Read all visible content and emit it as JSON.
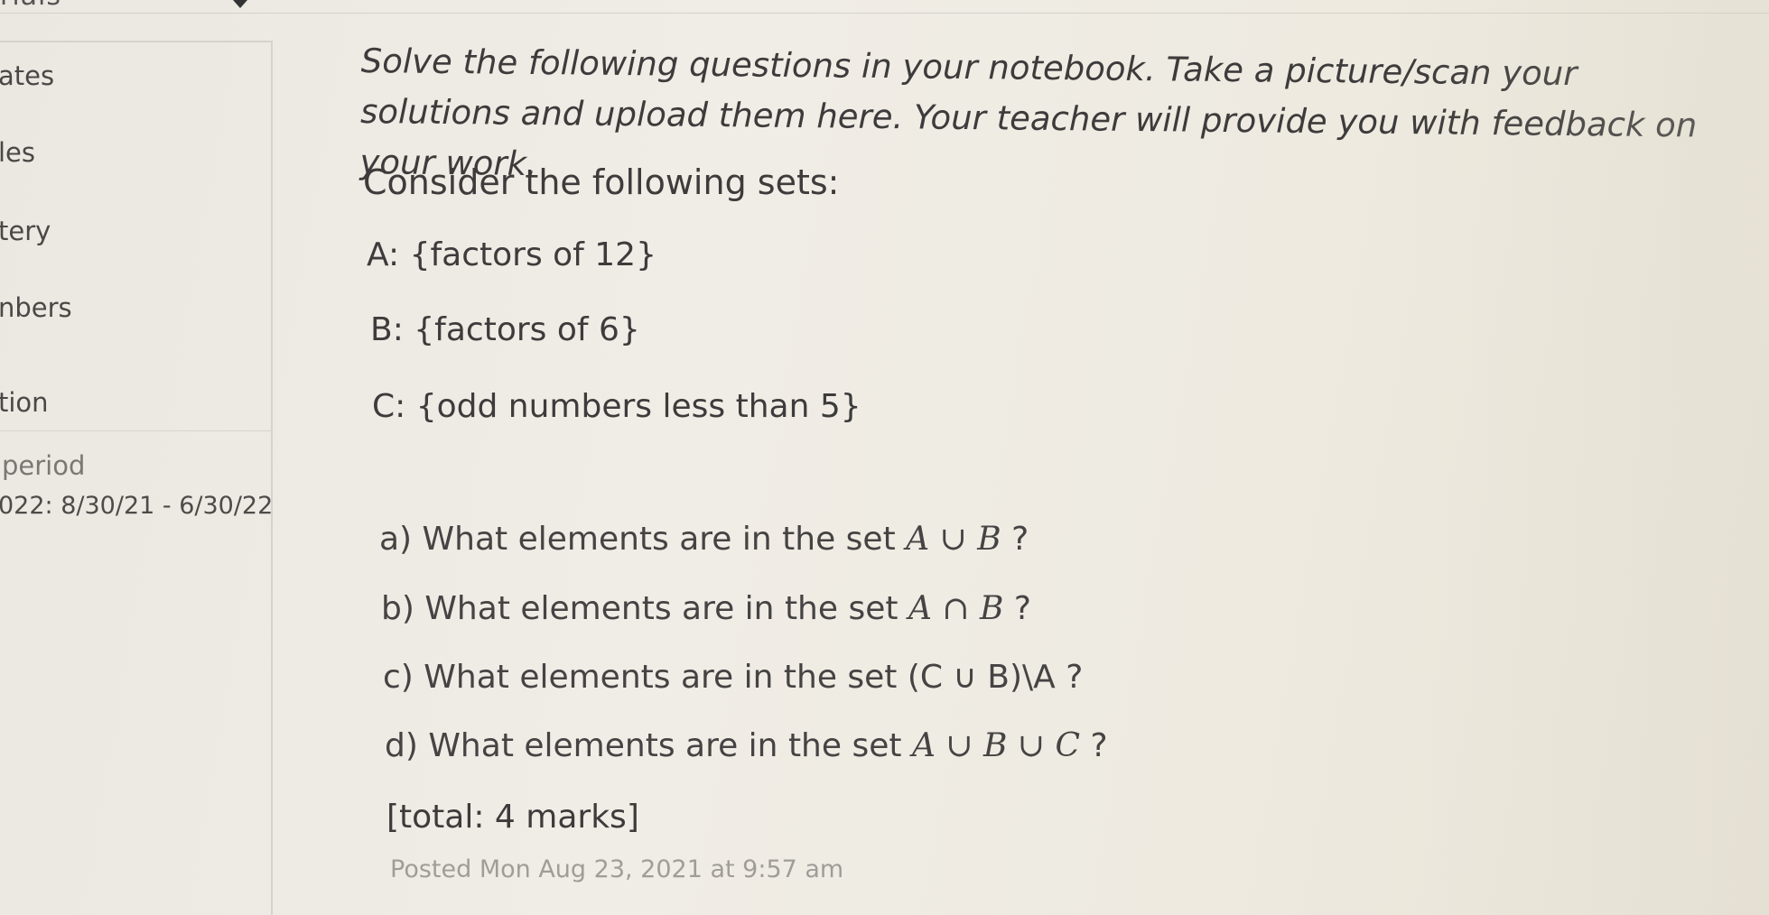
{
  "top_bar": {
    "cut_label": "rials"
  },
  "sidebar": {
    "items": [
      {
        "label": "ates"
      },
      {
        "label": "les"
      },
      {
        "label": "tery"
      },
      {
        "label": "nbers"
      },
      {
        "label": "tion"
      }
    ],
    "period_label": "period",
    "period_dates": "022: 8/30/21 - 6/30/22"
  },
  "assignment": {
    "instructions": "Solve the following questions in your notebook. Take a picture/scan your solutions and upload them here. Your teacher will provide you with feedback on your work.",
    "sets_heading": "Consider the following sets:",
    "sets": [
      "A: {factors of 12}",
      "B: {factors of 6}",
      "C: {odd numbers less than 5}"
    ],
    "questions": [
      {
        "prefix": "a) What elements are in the set ",
        "math": "A ∪ B",
        "suffix": " ?"
      },
      {
        "prefix": "b) What elements are in the set ",
        "math": "A ∩ B",
        "suffix": " ?"
      },
      {
        "prefix": "c) What elements are in the set (C ∪ B)\\A ?",
        "math": "",
        "suffix": ""
      },
      {
        "prefix": "d) What elements are in the set ",
        "math": "A ∪ B ∪ C",
        "suffix": " ?"
      }
    ],
    "total": "[total: 4 marks]",
    "posted": "Posted Mon Aug 23, 2021 at 9:57 am"
  }
}
